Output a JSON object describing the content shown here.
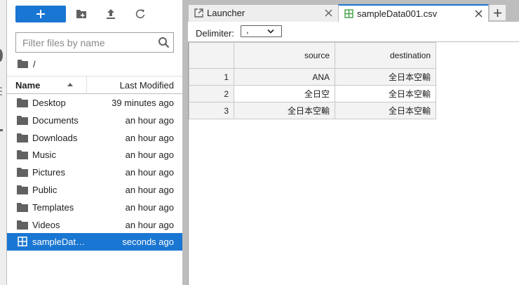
{
  "file_browser": {
    "search_placeholder": "Filter files by name",
    "breadcrumb_root": "/",
    "column_name": "Name",
    "column_modified": "Last Modified",
    "sort": "name-ascending",
    "files": [
      {
        "name": "Desktop",
        "modified": "39 minutes ago",
        "type": "folder",
        "selected": false
      },
      {
        "name": "Documents",
        "modified": "an hour ago",
        "type": "folder",
        "selected": false
      },
      {
        "name": "Downloads",
        "modified": "an hour ago",
        "type": "folder",
        "selected": false
      },
      {
        "name": "Music",
        "modified": "an hour ago",
        "type": "folder",
        "selected": false
      },
      {
        "name": "Pictures",
        "modified": "an hour ago",
        "type": "folder",
        "selected": false
      },
      {
        "name": "Public",
        "modified": "an hour ago",
        "type": "folder",
        "selected": false
      },
      {
        "name": "Templates",
        "modified": "an hour ago",
        "type": "folder",
        "selected": false
      },
      {
        "name": "Videos",
        "modified": "an hour ago",
        "type": "folder",
        "selected": false
      },
      {
        "name": "sampleDat…",
        "modified": "seconds ago",
        "type": "csv",
        "selected": true
      }
    ]
  },
  "tabs": [
    {
      "label": "Launcher",
      "icon": "launcher-icon",
      "active": false
    },
    {
      "label": "sampleData001.csv",
      "icon": "spreadsheet-icon",
      "active": true
    }
  ],
  "csv_viewer": {
    "delimiter_label": "Delimiter:",
    "delimiter_value": ",",
    "headers": [
      "source",
      "destination"
    ],
    "rows": [
      {
        "index": "1",
        "cells": [
          "ANA",
          "全日本空輸"
        ]
      },
      {
        "index": "2",
        "cells": [
          "全日空",
          "全日本空輸"
        ]
      },
      {
        "index": "3",
        "cells": [
          "全日本空輸",
          "全日本空輸"
        ]
      }
    ]
  },
  "colors": {
    "accent": "#1976d2",
    "panel_border": "#bdbdbd",
    "header_bg": "#f3f3f3"
  }
}
